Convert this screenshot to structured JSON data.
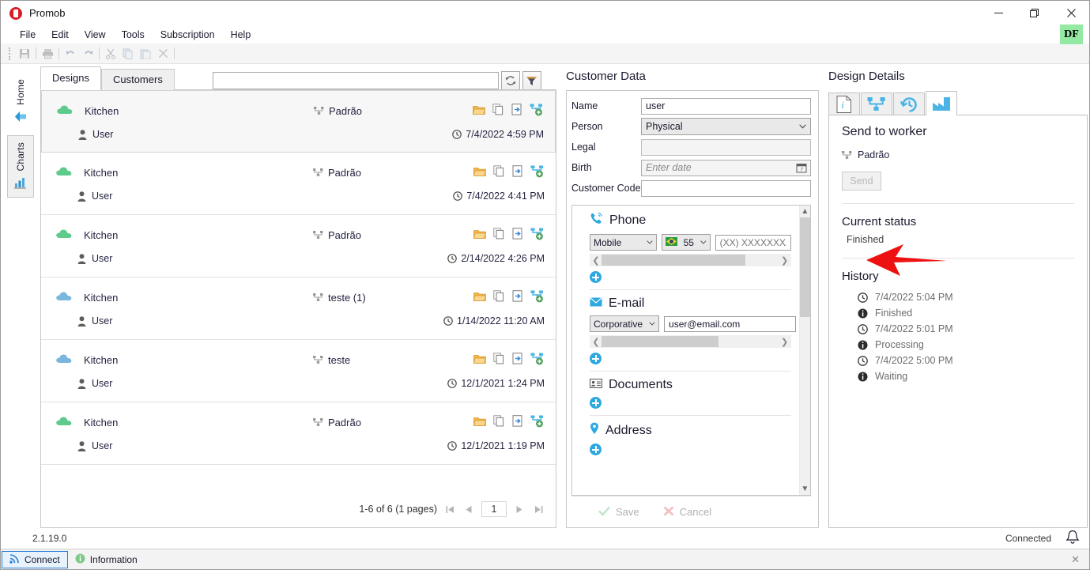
{
  "window": {
    "title": "Promob",
    "minimize": "─",
    "maximize": "❐",
    "close": "✕",
    "user_badge": "DF"
  },
  "menu": {
    "items": [
      "File",
      "Edit",
      "View",
      "Tools",
      "Subscription",
      "Help"
    ]
  },
  "toolbar": {
    "buttons": [
      {
        "name": "save-icon",
        "glyph": "💾"
      },
      {
        "name": "print-icon",
        "glyph": "🖨"
      },
      {
        "name": "undo-icon",
        "glyph": "↶"
      },
      {
        "name": "redo-icon",
        "glyph": "↷"
      },
      {
        "name": "cut-icon",
        "glyph": "✂"
      },
      {
        "name": "copy-icon",
        "glyph": "❐"
      },
      {
        "name": "paste-icon",
        "glyph": "📋"
      },
      {
        "name": "delete-icon",
        "glyph": "✕"
      }
    ]
  },
  "sidebar": {
    "items": [
      {
        "label": "Home",
        "icon": "home-arrow-icon",
        "active": false
      },
      {
        "label": "Charts",
        "icon": "bar-chart-icon",
        "active": true
      }
    ]
  },
  "designs_panel": {
    "tabs": [
      {
        "label": "Designs",
        "active": true
      },
      {
        "label": "Customers",
        "active": false
      }
    ],
    "search": {
      "value": "",
      "placeholder": ""
    },
    "refresh_icon": "refresh-icon",
    "filter_icon": "filter-icon",
    "row_actions": [
      "open-folder-icon",
      "copy-icon",
      "export-icon",
      "upload-network-icon"
    ],
    "rows": [
      {
        "name": "Kitchen",
        "cloud": "green",
        "layout": "Padrão",
        "user": "User",
        "date": "7/4/2022 4:59 PM",
        "selected": true
      },
      {
        "name": "Kitchen",
        "cloud": "green",
        "layout": "Padrão",
        "user": "User",
        "date": "7/4/2022 4:41 PM",
        "selected": false
      },
      {
        "name": "Kitchen",
        "cloud": "green",
        "layout": "Padrão",
        "user": "User",
        "date": "2/14/2022 4:26 PM",
        "selected": false
      },
      {
        "name": "Kitchen",
        "cloud": "blue",
        "layout": "teste (1)",
        "user": "User",
        "date": "1/14/2022 11:20 AM",
        "selected": false
      },
      {
        "name": "Kitchen",
        "cloud": "blue",
        "layout": "teste",
        "user": "User",
        "date": "12/1/2021 1:24 PM",
        "selected": false
      },
      {
        "name": "Kitchen",
        "cloud": "green",
        "layout": "Padrão",
        "user": "User",
        "date": "12/1/2021 1:19 PM",
        "selected": false
      }
    ],
    "pagination": {
      "summary": "1-6 of 6 (1 pages)",
      "first": "⏮",
      "prev": "◀",
      "page": "1",
      "next": "▶",
      "last": "⏭"
    }
  },
  "customer_data": {
    "title": "Customer Data",
    "fields": [
      {
        "label": "Name",
        "value": "user",
        "type": "input"
      },
      {
        "label": "Person",
        "value": "Physical",
        "type": "select"
      },
      {
        "label": "Legal",
        "value": "",
        "type": "readonly"
      },
      {
        "label": "Birth",
        "value": "",
        "placeholder": "Enter date",
        "type": "date"
      },
      {
        "label": "Customer Code",
        "value": "",
        "type": "input"
      }
    ],
    "sections": [
      {
        "title": "Phone",
        "icon": "phone-icon",
        "type_value": "Mobile",
        "country_code": "55",
        "country_flag": "brazil-flag-icon",
        "number_placeholder": "(XX) XXXXXXXX",
        "add_icon": "add-icon"
      },
      {
        "title": "E-mail",
        "icon": "envelope-icon",
        "type_value": "Corporative",
        "email_value": "user@email.com",
        "add_icon": "add-icon"
      },
      {
        "title": "Documents",
        "icon": "id-card-icon",
        "add_icon": "add-icon"
      },
      {
        "title": "Address",
        "icon": "map-pin-icon",
        "add_icon": "add-icon"
      }
    ],
    "actions": {
      "save_label": "Save",
      "save_icon": "check-icon",
      "cancel_label": "Cancel",
      "cancel_icon": "x-icon"
    }
  },
  "design_details": {
    "title": "Design Details",
    "tabs": [
      {
        "icon": "info-document-icon",
        "active": false
      },
      {
        "icon": "hierarchy-icon",
        "active": false
      },
      {
        "icon": "history-clock-icon",
        "active": false
      },
      {
        "icon": "factory-icon",
        "active": true
      }
    ],
    "send_section": {
      "heading": "Send to worker",
      "layout_label": "Padrão",
      "layout_icon": "hierarchy-icon",
      "button_label": "Send",
      "button_enabled": false
    },
    "current_status": {
      "heading": "Current status",
      "value": "Finished"
    },
    "history": {
      "heading": "History",
      "entries": [
        {
          "icon": "clock-icon",
          "time": "7/4/2022 5:04 PM",
          "status_icon": "info-icon",
          "status": "Finished"
        },
        {
          "icon": "clock-icon",
          "time": "7/4/2022 5:01 PM",
          "status_icon": "info-icon",
          "status": "Processing"
        },
        {
          "icon": "clock-icon",
          "time": "7/4/2022 5:00 PM",
          "status_icon": "info-icon",
          "status": "Waiting"
        }
      ]
    },
    "annotation": {
      "type": "red-arrow",
      "color": "#ee1111",
      "points_to": "send-button"
    }
  },
  "footer": {
    "version": "2.1.19.0",
    "connection_status": "Connected",
    "bell_icon": "bell-icon",
    "statusbar": {
      "connect_label": "Connect",
      "connect_icon": "signal-icon",
      "information_label": "Information",
      "information_icon": "info-icon",
      "close_icon": "✕"
    }
  },
  "colors": {
    "cloud_green": "#5ecb8d",
    "cloud_blue": "#7bb6dd",
    "accent_blue": "#2ea8e0",
    "tab_active_blue": "#4bb4e6",
    "badge_green": "#94eaa2",
    "arrow_red": "#ee1111"
  }
}
